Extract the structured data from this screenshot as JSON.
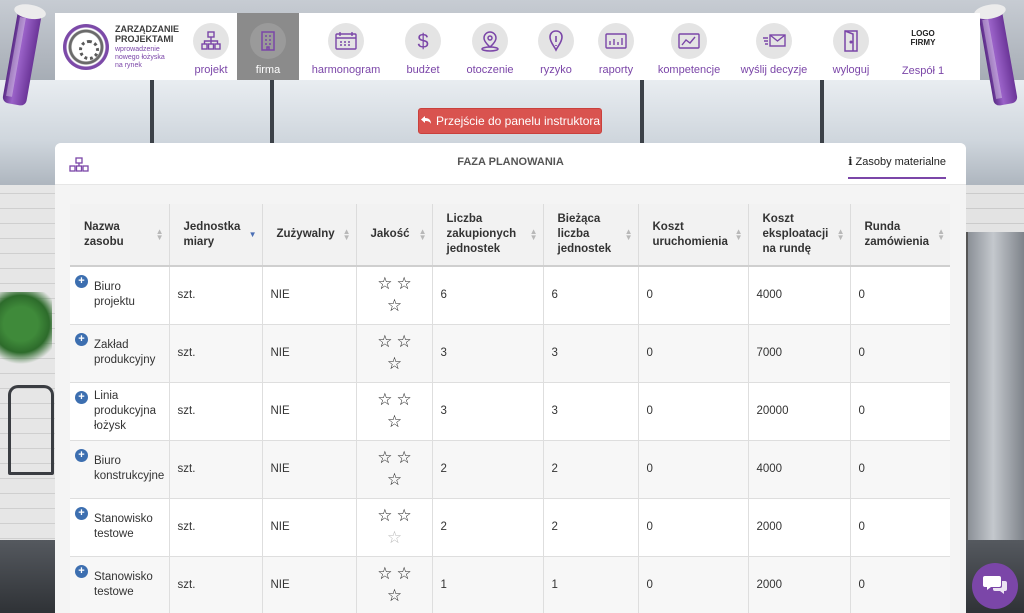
{
  "brand": {
    "line1": "ZARZĄDZANIE",
    "line2": "PROJEKTAMI",
    "line3": "wprowadzenie",
    "line4": "nowego łożyska",
    "line5": "na rynek"
  },
  "nav": {
    "items": [
      {
        "label": "projekt",
        "icon": "org-chart-icon",
        "active": false
      },
      {
        "label": "firma",
        "icon": "building-icon",
        "active": true
      },
      {
        "label": "harmonogram",
        "icon": "calendar-icon",
        "active": false
      },
      {
        "label": "budżet",
        "icon": "dollar-icon",
        "active": false
      },
      {
        "label": "otoczenie",
        "icon": "map-pin-icon",
        "active": false
      },
      {
        "label": "ryzyko",
        "icon": "warning-icon",
        "active": false
      },
      {
        "label": "raporty",
        "icon": "report-icon",
        "active": false
      },
      {
        "label": "kompetencje",
        "icon": "chart-icon",
        "active": false
      },
      {
        "label": "wyślij decyzje",
        "icon": "send-mail-icon",
        "active": false
      },
      {
        "label": "wyloguj",
        "icon": "logout-door-icon",
        "active": false
      }
    ],
    "logo_line1": "LOGO",
    "logo_line2": "FIRMY",
    "team": "Zespół 1"
  },
  "instructor_button": "Przejście do panelu instruktora",
  "panel": {
    "title": "FAZA PLANOWANIA",
    "tab": "Zasoby materialne",
    "tab_icon": "info-icon"
  },
  "table": {
    "headers": [
      {
        "l1": "Nazwa",
        "l2": "zasobu",
        "l3": ""
      },
      {
        "l1": "Jednostka",
        "l2": "miary",
        "l3": ""
      },
      {
        "l1": "Zużywalny",
        "l2": "",
        "l3": ""
      },
      {
        "l1": "Jakość",
        "l2": "",
        "l3": ""
      },
      {
        "l1": "Liczba",
        "l2": "zakupionych",
        "l3": "jednostek"
      },
      {
        "l1": "Bieżąca",
        "l2": "liczba",
        "l3": "jednostek"
      },
      {
        "l1": "Koszt",
        "l2": "uruchomienia",
        "l3": ""
      },
      {
        "l1": "Koszt",
        "l2": "eksploatacji",
        "l3": "na rundę"
      },
      {
        "l1": "Runda",
        "l2": "zamówienia",
        "l3": ""
      }
    ],
    "rows": [
      {
        "n1": "Biuro",
        "n2": "projektu",
        "n3": "",
        "unit": "szt.",
        "consumable": "NIE",
        "quality": 3,
        "bought": "6",
        "current": "6",
        "startup": "0",
        "opcost": "4000",
        "round": "0"
      },
      {
        "n1": "Zakład",
        "n2": "produkcyjny",
        "n3": "",
        "unit": "szt.",
        "consumable": "NIE",
        "quality": 3,
        "bought": "3",
        "current": "3",
        "startup": "0",
        "opcost": "7000",
        "round": "0"
      },
      {
        "n1": "Linia",
        "n2": "produkcyjna",
        "n3": "łożysk",
        "unit": "szt.",
        "consumable": "NIE",
        "quality": 3,
        "bought": "3",
        "current": "3",
        "startup": "0",
        "opcost": "20000",
        "round": "0"
      },
      {
        "n1": "Biuro",
        "n2": "konstrukcyjne",
        "n3": "",
        "unit": "szt.",
        "consumable": "NIE",
        "quality": 3,
        "bought": "2",
        "current": "2",
        "startup": "0",
        "opcost": "4000",
        "round": "0"
      },
      {
        "n1": "Stanowisko",
        "n2": "testowe",
        "n3": "",
        "unit": "szt.",
        "consumable": "NIE",
        "quality": 2,
        "bought": "2",
        "current": "2",
        "startup": "0",
        "opcost": "2000",
        "round": "0"
      },
      {
        "n1": "Stanowisko",
        "n2": "testowe",
        "n3": "",
        "unit": "szt.",
        "consumable": "NIE",
        "quality": 3,
        "bought": "1",
        "current": "1",
        "startup": "0",
        "opcost": "2000",
        "round": "0"
      }
    ]
  },
  "colors": {
    "accent": "#7b46a8",
    "button_red": "#d9534f",
    "expand_blue": "#3d6fb0"
  }
}
